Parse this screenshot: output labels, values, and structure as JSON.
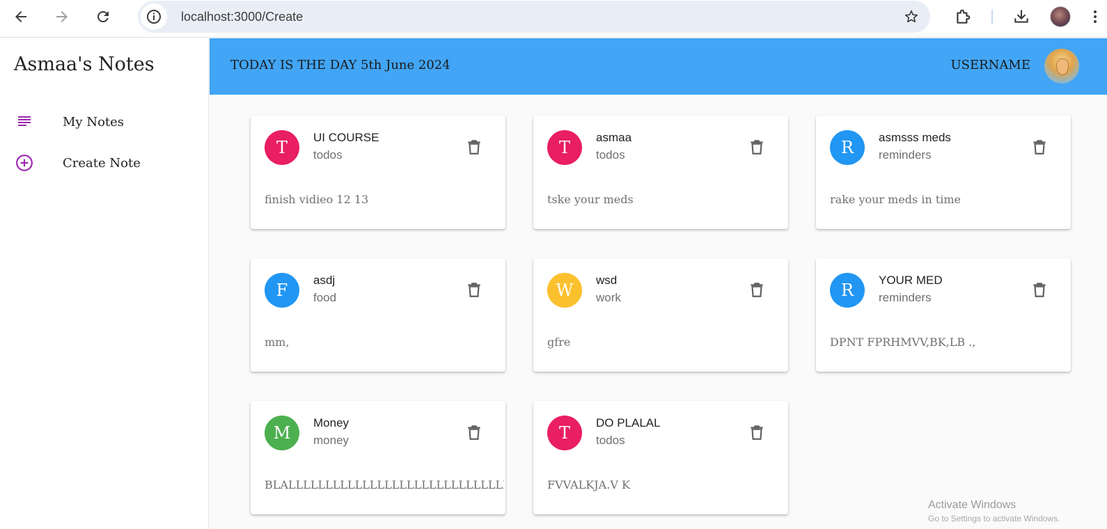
{
  "browser": {
    "url": "localhost:3000/Create"
  },
  "sidebar": {
    "title": "Asmaa's Notes",
    "items": [
      {
        "label": "My Notes",
        "icon": "list-icon"
      },
      {
        "label": "Create Note",
        "icon": "add-circle-icon"
      }
    ],
    "accent_color": "#9c27b0"
  },
  "header": {
    "date_text": "TODAY IS THE DAY 5th June 2024",
    "username": "USERNAME",
    "background_color": "#42a5f5"
  },
  "notes": [
    {
      "initial": "T",
      "title": "UI COURSE",
      "category": "todos",
      "details": "finish vidieo 12 13",
      "color": "#e91e63"
    },
    {
      "initial": "T",
      "title": "asmaa",
      "category": "todos",
      "details": "tske your meds",
      "color": "#e91e63"
    },
    {
      "initial": "R",
      "title": "asmsss meds",
      "category": "reminders",
      "details": "rake your meds in time",
      "color": "#2196f3"
    },
    {
      "initial": "F",
      "title": "asdj",
      "category": "food",
      "details": "mm,",
      "color": "#2196f3"
    },
    {
      "initial": "W",
      "title": "wsd",
      "category": "work",
      "details": "gfre",
      "color": "#fbc02d"
    },
    {
      "initial": "R",
      "title": "YOUR MED",
      "category": "reminders",
      "details": "DPNT FPRHMVV,BK,LB .,",
      "color": "#2196f3"
    },
    {
      "initial": "M",
      "title": "Money",
      "category": "money",
      "details": "BLALLLLLLLLLLLLLLLLLLLLLLLLLLLLLLLLLLLLLLLLLLL",
      "color": "#4caf50"
    },
    {
      "initial": "T",
      "title": "DO PLALAL",
      "category": "todos",
      "details": "FVVALKJA.V K",
      "color": "#e91e63"
    }
  ],
  "watermark": {
    "line1": "Activate Windows",
    "line2": "Go to Settings to activate Windows."
  }
}
